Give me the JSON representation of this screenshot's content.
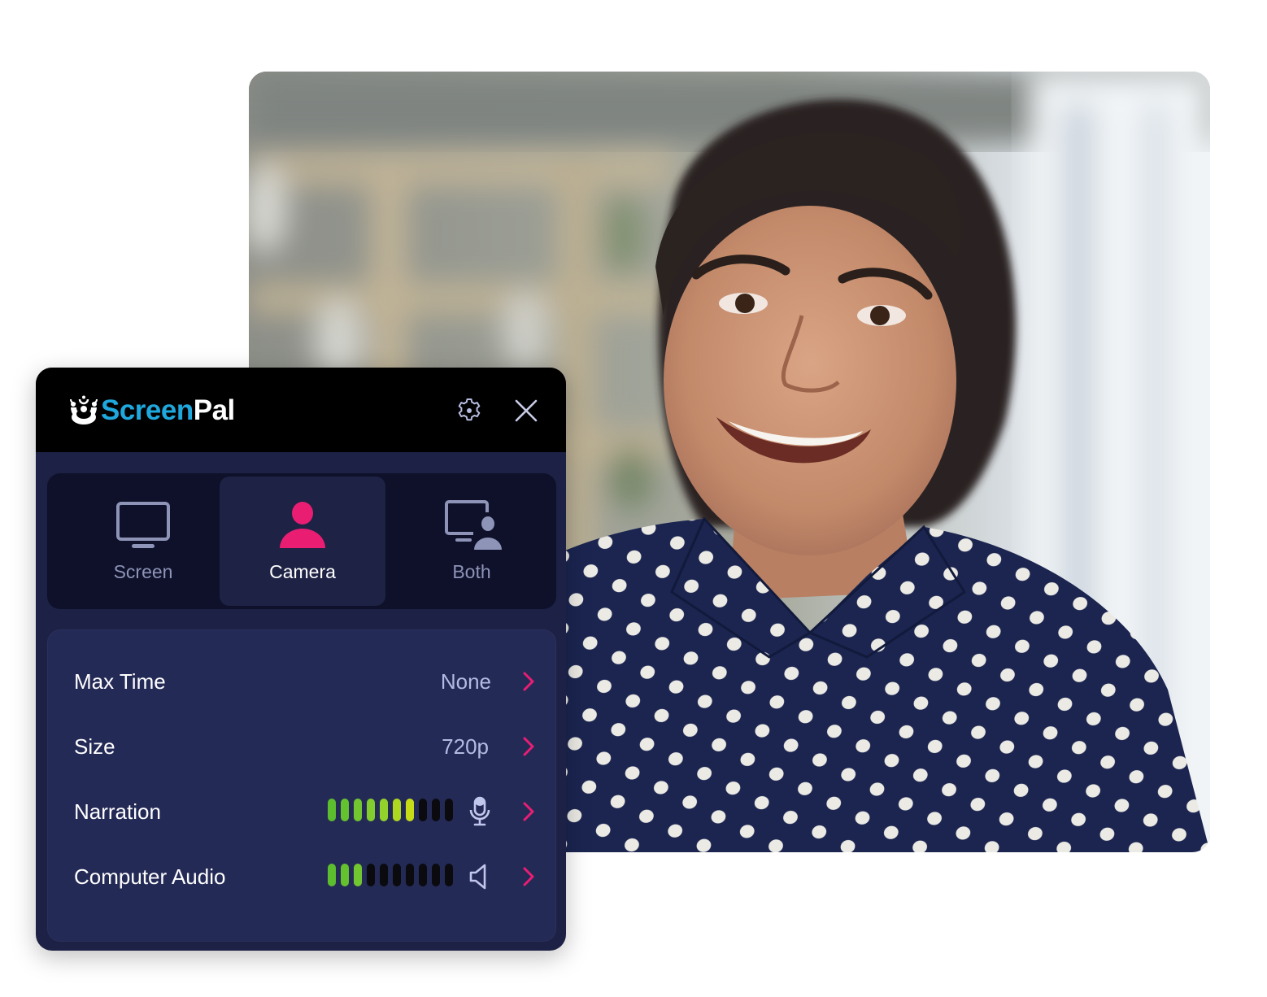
{
  "app": {
    "logo_text_part1": "Screen",
    "logo_text_part2": "Pal",
    "brand_color": "#1fa8de",
    "accent_color": "#e91e73"
  },
  "titlebar": {
    "settings_icon": "gear-icon",
    "close_icon": "close-icon"
  },
  "modes": [
    {
      "label": "Screen",
      "icon": "monitor-icon",
      "active": false
    },
    {
      "label": "Camera",
      "icon": "person-icon",
      "active": true
    },
    {
      "label": "Both",
      "icon": "monitor-person-icon",
      "active": false
    }
  ],
  "settings": {
    "max_time": {
      "label": "Max Time",
      "value": "None"
    },
    "size": {
      "label": "Size",
      "value": "720p"
    },
    "narration": {
      "label": "Narration",
      "level_bars_lit": 7,
      "level_bars_total": 10,
      "icon": "microphone-icon"
    },
    "computer_audio": {
      "label": "Computer Audio",
      "level_bars_lit": 3,
      "level_bars_total": 10,
      "icon": "speaker-icon"
    }
  },
  "photo": {
    "description": "smiling woman in navy polka-dot blouse, webcam view"
  }
}
